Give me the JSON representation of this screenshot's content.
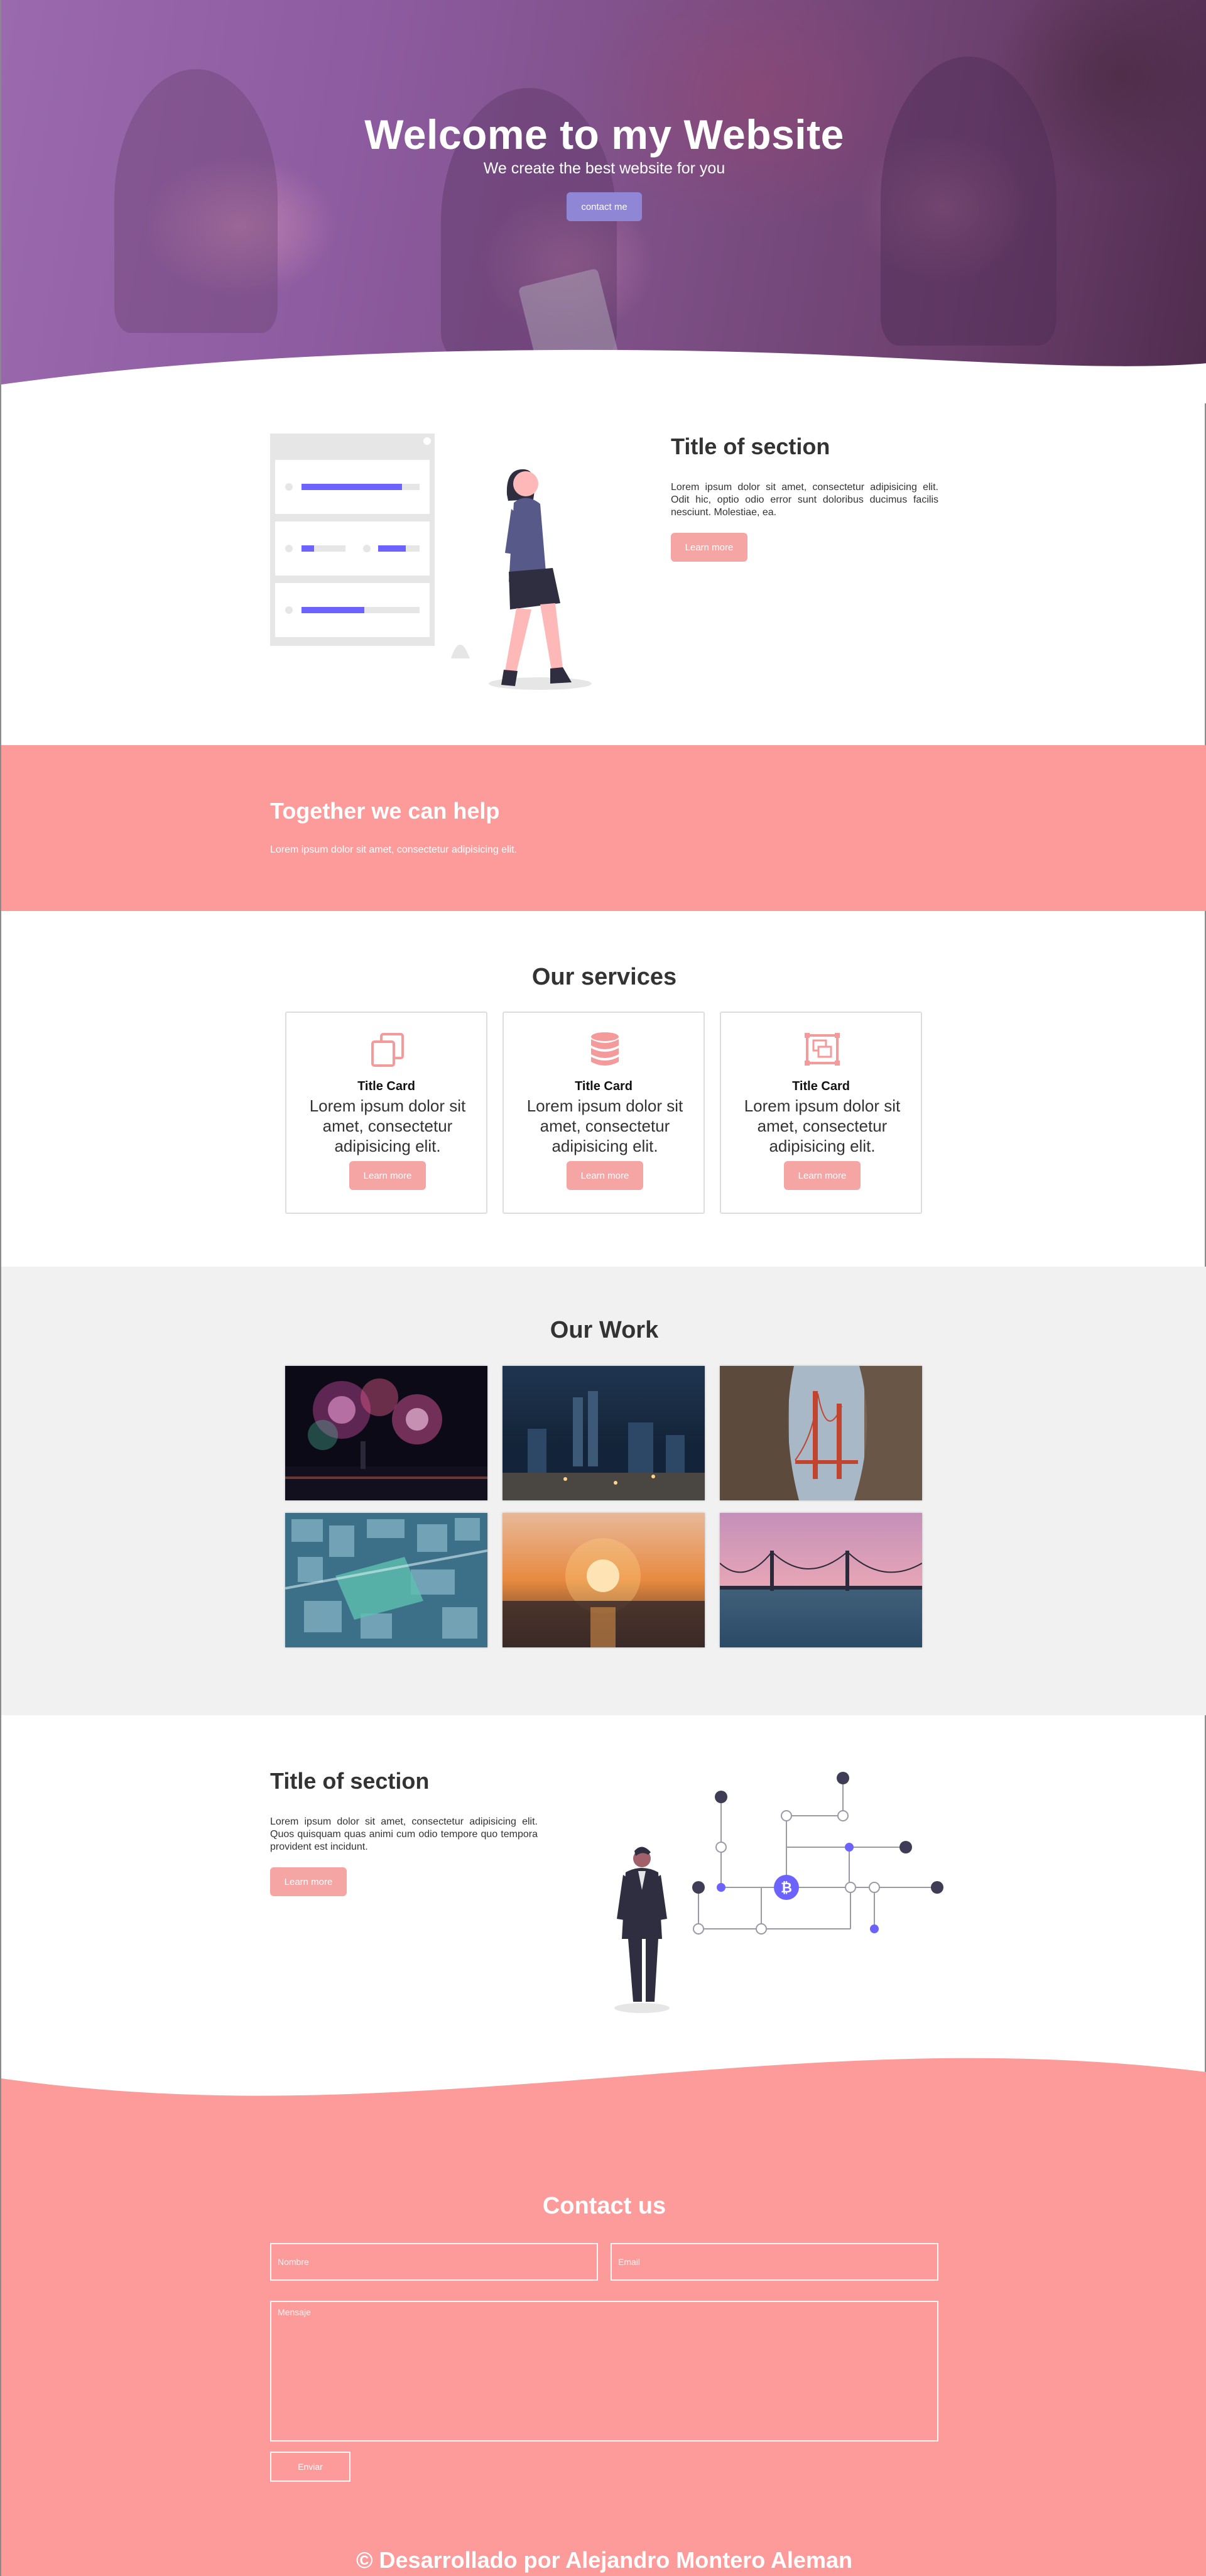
{
  "hero": {
    "title": "Welcome to my Website",
    "subtitle": "We create the best website for you",
    "button_label": "contact me"
  },
  "section_one": {
    "title": "Title of section",
    "text": "Lorem ipsum dolor sit amet, consectetur adipisicing elit. Odit hic, optio odio error sunt doloribus ducimus facilis nesciunt. Molestiae, ea.",
    "button_label": "Learn more"
  },
  "band": {
    "title": "Together we can help",
    "text": "Lorem ipsum dolor sit amet, consectetur adipisicing elit."
  },
  "services": {
    "title": "Our services",
    "cards": [
      {
        "icon": "copy-icon",
        "title": "Title Card",
        "text": "Lorem ipsum dolor sit amet, consectetur adipisicing elit.",
        "button_label": "Learn more"
      },
      {
        "icon": "database-icon",
        "title": "Title Card",
        "text": "Lorem ipsum dolor sit amet, consectetur adipisicing elit.",
        "button_label": "Learn more"
      },
      {
        "icon": "photo-gallery-icon",
        "title": "Title Card",
        "text": "Lorem ipsum dolor sit amet, consectetur adipisicing elit.",
        "button_label": "Learn more"
      }
    ]
  },
  "work": {
    "title": "Our Work",
    "images": [
      "fireworks",
      "city-night",
      "golden-gate-bridge",
      "aerial-city",
      "sunset-city",
      "bay-bridge"
    ]
  },
  "section_two": {
    "title": "Title of section",
    "text": "Lorem ipsum dolor sit amet, consectetur adipisicing elit. Quos quisquam quas animi cum odio tempore quo tempora provident est incidunt.",
    "button_label": "Learn more"
  },
  "contact": {
    "title": "Contact us",
    "name_placeholder": "Nombre",
    "email_placeholder": "Email",
    "message_placeholder": "Mensaje",
    "submit_label": "Enviar"
  },
  "footer": {
    "text": "© Desarrollado por Alejandro Montero Aleman"
  },
  "colors": {
    "accent_pink": "#fd9b9b",
    "button_pink": "#f5a6a4",
    "hero_button": "#8f86d6",
    "illustration_purple": "#6c63ff"
  }
}
